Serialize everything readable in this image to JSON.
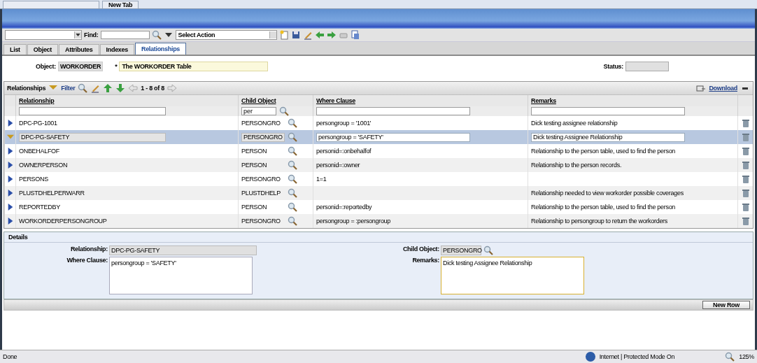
{
  "browser_tabs": [
    {
      "label": "New Tab"
    }
  ],
  "toolbar": {
    "find_label": "Find:",
    "action": "Select Action"
  },
  "tabs": [
    {
      "label": "List",
      "selected": false
    },
    {
      "label": "Object",
      "selected": false
    },
    {
      "label": "Attributes",
      "selected": false
    },
    {
      "label": "Indexes",
      "selected": false
    },
    {
      "label": "Relationships",
      "selected": true
    }
  ],
  "object": {
    "label": "Object:",
    "value": "WORKORDER",
    "required_mark": "*",
    "description": "The WORKORDER Table",
    "status_label": "Status:"
  },
  "table": {
    "title": "Relationships",
    "filter": "Filter",
    "pager": "1 - 8 of 8",
    "download": "Download",
    "columns": [
      "Relationship",
      "Child Object",
      "Where Clause",
      "Remarks"
    ],
    "filter_values": {
      "child_object": "per"
    },
    "rows": [
      {
        "relationship": "DPC-PG-1001",
        "child_object": "PERSONGRO",
        "where_clause": "persongroup = '1001'",
        "remarks": "Dick testing assignee relationship",
        "expanded": false
      },
      {
        "relationship": "DPC-PG-SAFETY",
        "child_object": "PERSONGRO",
        "where_clause": "persongroup = 'SAFETY'",
        "remarks": "Dick testing Assignee Relationship",
        "expanded": true
      },
      {
        "relationship": "ONBEHALFOF",
        "child_object": "PERSON",
        "where_clause": "personid=:onbehalfof",
        "remarks": "Relationship to the person table, used to find the person",
        "expanded": false
      },
      {
        "relationship": "OWNERPERSON",
        "child_object": "PERSON",
        "where_clause": "personid=:owner",
        "remarks": "Relationship to the person records.",
        "expanded": false
      },
      {
        "relationship": "PERSONS",
        "child_object": "PERSONGRO",
        "where_clause": "1=1",
        "remarks": "",
        "expanded": false
      },
      {
        "relationship": "PLUSTDHELPERWARR",
        "child_object": "PLUSTDHELP",
        "where_clause": "",
        "remarks": "Relationship needed to view workorder possible coverages",
        "expanded": false
      },
      {
        "relationship": "REPORTEDBY",
        "child_object": "PERSON",
        "where_clause": "personid=:reportedby",
        "remarks": "Relationship to the person table, used to find the person",
        "expanded": false
      },
      {
        "relationship": "WORKORDERPERSONGROUP",
        "child_object": "PERSONGRO",
        "where_clause": "persongroup = :persongroup",
        "remarks": "Relationship to persongroup to return the workorders",
        "expanded": false
      }
    ]
  },
  "details": {
    "title": "Details",
    "relationship_label": "Relationship:",
    "relationship": "DPC-PG-SAFETY",
    "where_label": "Where Clause:",
    "where_clause": "persongroup = 'SAFETY'",
    "child_label": "Child Object:",
    "child_object": "PERSONGRO",
    "remarks_label": "Remarks:",
    "remarks": "Dick testing Assignee Relationship"
  },
  "new_row": "New Row",
  "status_bar": {
    "status": "Done",
    "zone": "Internet | Protected Mode On",
    "zoom": "125%"
  }
}
